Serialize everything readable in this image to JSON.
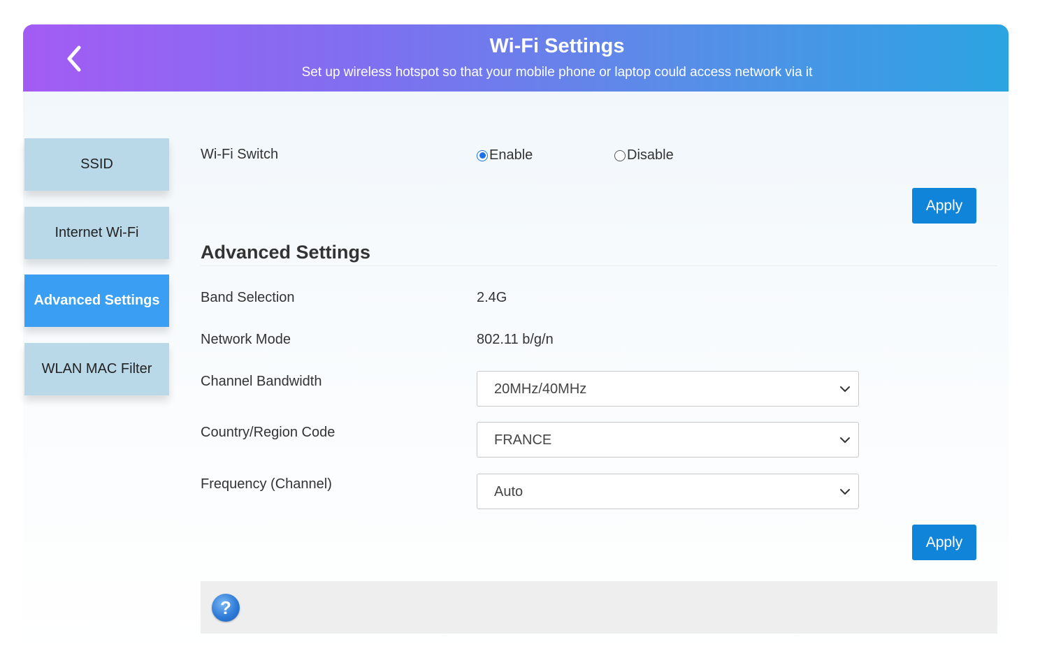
{
  "header": {
    "title": "Wi-Fi Settings",
    "subtitle": "Set up wireless hotspot so that your mobile phone or laptop could access network via it",
    "back_icon": "chevron-left-icon"
  },
  "sidebar": {
    "items": [
      {
        "label": "SSID",
        "active": false
      },
      {
        "label": "Internet Wi-Fi",
        "active": false
      },
      {
        "label": "Advanced Settings",
        "active": true
      },
      {
        "label": "WLAN MAC Filter",
        "active": false
      }
    ]
  },
  "wifi_switch": {
    "label": "Wi-Fi Switch",
    "options": [
      {
        "label": "Enable",
        "checked": true
      },
      {
        "label": "Disable",
        "checked": false
      }
    ],
    "apply_label": "Apply"
  },
  "advanced": {
    "title": "Advanced Settings",
    "band_selection": {
      "label": "Band Selection",
      "value": "2.4G"
    },
    "network_mode": {
      "label": "Network Mode",
      "value": "802.11 b/g/n"
    },
    "channel_bandwidth": {
      "label": "Channel Bandwidth",
      "value": "20MHz/40MHz"
    },
    "country_region": {
      "label": "Country/Region Code",
      "value": "FRANCE"
    },
    "frequency": {
      "label": "Frequency (Channel)",
      "value": "Auto"
    },
    "apply_label": "Apply"
  },
  "help": {
    "icon": "help-icon",
    "symbol": "?"
  },
  "colors": {
    "accent_blue": "#0f84d8",
    "active_tab": "#3a9ef2",
    "inactive_tab": "#b9d9e9",
    "header_gradient_start": "#a35cf4",
    "header_gradient_end": "#2ba4e2"
  }
}
